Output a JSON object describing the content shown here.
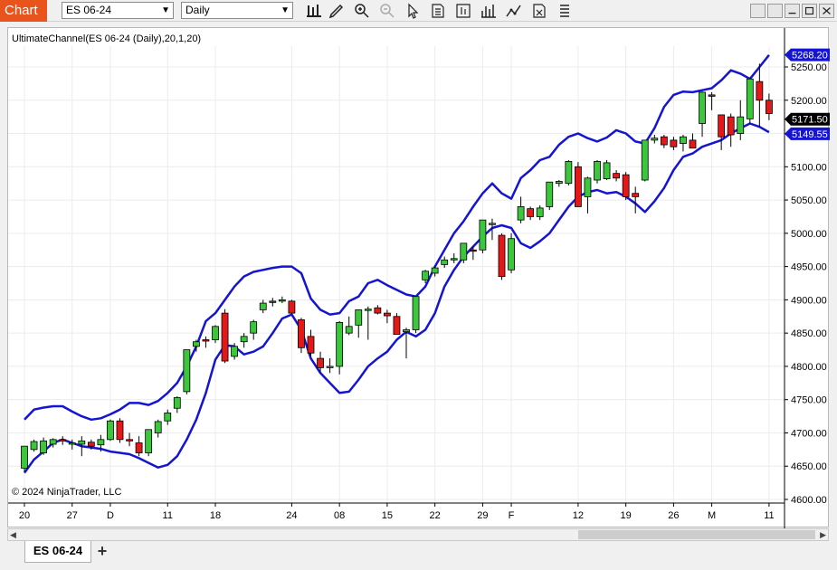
{
  "app": {
    "title": "Chart"
  },
  "toolbar": {
    "instrument": "ES 06-24",
    "period": "Daily",
    "icons": [
      "bar-type-icon",
      "drawing-tool-icon",
      "zoom-in-icon",
      "zoom-out-icon",
      "pointer-icon",
      "data-box-icon",
      "chart-style-icon",
      "indicators-icon",
      "strategies-icon",
      "properties-icon",
      "templates-icon"
    ],
    "window_buttons": [
      "restore-icon",
      "minimize-icon",
      "maximize-icon",
      "close-icon"
    ]
  },
  "chart": {
    "indicator_label": "UltimateChannel(ES 06-24 (Daily),20,1,20)",
    "copyright": "© 2024 NinjaTrader, LLC"
  },
  "tabs": {
    "active": "ES 06-24",
    "add_label": "+"
  },
  "colors": {
    "up": "#3cc63c",
    "down": "#e31919",
    "channel": "#1414d2",
    "accent": "#e8541c",
    "price_tag": "#000000",
    "channel_tag": "#1414d2"
  },
  "chart_data": {
    "type": "candlestick",
    "ylim": [
      4600,
      5300
    ],
    "yticks": [
      "5250.00",
      "5200.00",
      "5150.00",
      "5100.00",
      "5050.00",
      "5000.00",
      "4950.00",
      "4900.00",
      "4850.00",
      "4800.00",
      "4750.00",
      "4700.00",
      "4650.00",
      "4600.00"
    ],
    "xticks": [
      "20",
      "27",
      "D",
      "11",
      "18",
      "24",
      "08",
      "15",
      "22",
      "29",
      "F",
      "12",
      "19",
      "26",
      "M",
      "11"
    ],
    "xtick_bars": [
      0,
      5,
      9,
      15,
      20,
      28,
      33,
      38,
      43,
      48,
      51,
      58,
      63,
      68,
      72,
      78
    ],
    "price_tags": [
      {
        "value": 5268.2,
        "label": "5268.20",
        "kind": "channel"
      },
      {
        "value": 5171.5,
        "label": "5171.50",
        "kind": "price"
      },
      {
        "value": 5149.55,
        "label": "5149.55",
        "kind": "channel"
      }
    ],
    "candles": [
      [
        4647,
        4680,
        4642,
        4680
      ],
      [
        4675,
        4690,
        4672,
        4687
      ],
      [
        4670,
        4693,
        4667,
        4688
      ],
      [
        4683,
        4692,
        4678,
        4690
      ],
      [
        4690,
        4695,
        4682,
        4689
      ],
      [
        4685,
        4690,
        4675,
        4685
      ],
      [
        4683,
        4695,
        4665,
        4688
      ],
      [
        4686,
        4690,
        4675,
        4680
      ],
      [
        4682,
        4697,
        4672,
        4690
      ],
      [
        4690,
        4720,
        4688,
        4718
      ],
      [
        4718,
        4722,
        4685,
        4690
      ],
      [
        4690,
        4700,
        4680,
        4688
      ],
      [
        4685,
        4695,
        4665,
        4670
      ],
      [
        4670,
        4705,
        4665,
        4705
      ],
      [
        4700,
        4720,
        4693,
        4717
      ],
      [
        4718,
        4735,
        4712,
        4730
      ],
      [
        4737,
        4755,
        4730,
        4753
      ],
      [
        4762,
        4825,
        4758,
        4825
      ],
      [
        4830,
        4840,
        4822,
        4837
      ],
      [
        4840,
        4845,
        4828,
        4838
      ],
      [
        4840,
        4862,
        4835,
        4860
      ],
      [
        4880,
        4886,
        4805,
        4808
      ],
      [
        4815,
        4835,
        4810,
        4830
      ],
      [
        4837,
        4850,
        4828,
        4845
      ],
      [
        4850,
        4870,
        4840,
        4867
      ],
      [
        4885,
        4900,
        4880,
        4895
      ],
      [
        4898,
        4903,
        4890,
        4897
      ],
      [
        4898,
        4905,
        4895,
        4900
      ],
      [
        4898,
        4900,
        4882,
        4880
      ],
      [
        4870,
        4873,
        4820,
        4828
      ],
      [
        4845,
        4855,
        4815,
        4820
      ],
      [
        4812,
        4822,
        4790,
        4798
      ],
      [
        4798,
        4812,
        4790,
        4800
      ],
      [
        4800,
        4868,
        4788,
        4866
      ],
      [
        4850,
        4875,
        4847,
        4860
      ],
      [
        4862,
        4875,
        4843,
        4885
      ],
      [
        4886,
        4890,
        4840,
        4886
      ],
      [
        4888,
        4892,
        4878,
        4880
      ],
      [
        4880,
        4885,
        4865,
        4876
      ],
      [
        4875,
        4880,
        4850,
        4848
      ],
      [
        4852,
        4858,
        4812,
        4855
      ],
      [
        4855,
        4900,
        4850,
        4905
      ],
      [
        4930,
        4945,
        4925,
        4943
      ],
      [
        4940,
        4950,
        4935,
        4948
      ],
      [
        4953,
        4965,
        4948,
        4960
      ],
      [
        4960,
        4970,
        4955,
        4962
      ],
      [
        4960,
        4985,
        4955,
        4985
      ],
      [
        4975,
        4980,
        4960,
        4973
      ],
      [
        4975,
        5020,
        4970,
        5020
      ],
      [
        5015,
        5022,
        4990,
        5015
      ],
      [
        4997,
        5000,
        4930,
        4935
      ],
      [
        4945,
        5000,
        4940,
        4992
      ],
      [
        5020,
        5055,
        5015,
        5040
      ],
      [
        5037,
        5040,
        5020,
        5025
      ],
      [
        5025,
        5042,
        5020,
        5038
      ],
      [
        5040,
        5075,
        5035,
        5077
      ],
      [
        5075,
        5080,
        5070,
        5078
      ],
      [
        5075,
        5110,
        5072,
        5108
      ],
      [
        5100,
        5107,
        5040,
        5040
      ],
      [
        5055,
        5085,
        5030,
        5083
      ],
      [
        5080,
        5110,
        5075,
        5108
      ],
      [
        5082,
        5110,
        5080,
        5106
      ],
      [
        5090,
        5095,
        5078,
        5083
      ],
      [
        5088,
        5092,
        5050,
        5055
      ],
      [
        5060,
        5070,
        5030,
        5055
      ],
      [
        5080,
        5140,
        5078,
        5140
      ],
      [
        5140,
        5148,
        5135,
        5143
      ],
      [
        5145,
        5148,
        5128,
        5133
      ],
      [
        5140,
        5145,
        5125,
        5130
      ],
      [
        5135,
        5148,
        5123,
        5145
      ],
      [
        5140,
        5150,
        5130,
        5128
      ],
      [
        5165,
        5213,
        5145,
        5212
      ],
      [
        5208,
        5212,
        5185,
        5206
      ],
      [
        5178,
        5175,
        5125,
        5145
      ],
      [
        5175,
        5180,
        5130,
        5148
      ],
      [
        5150,
        5200,
        5140,
        5175
      ],
      [
        5172,
        5234,
        5165,
        5232
      ],
      [
        5228,
        5255,
        5160,
        5200
      ],
      [
        5200,
        5210,
        5170,
        5180
      ]
    ],
    "upper_channel": [
      4720,
      4735,
      4738,
      4740,
      4740,
      4732,
      4725,
      4720,
      4722,
      4728,
      4735,
      4745,
      4745,
      4742,
      4748,
      4760,
      4775,
      4800,
      4830,
      4868,
      4880,
      4900,
      4920,
      4935,
      4942,
      4945,
      4948,
      4950,
      4950,
      4940,
      4902,
      4885,
      4878,
      4880,
      4898,
      4905,
      4925,
      4930,
      4922,
      4915,
      4908,
      4905,
      4920,
      4950,
      4975,
      5000,
      5018,
      5040,
      5060,
      5075,
      5060,
      5052,
      5083,
      5095,
      5110,
      5115,
      5133,
      5145,
      5150,
      5143,
      5138,
      5144,
      5155,
      5150,
      5138,
      5135,
      5158,
      5190,
      5208,
      5213,
      5212,
      5215,
      5218,
      5230,
      5245,
      5240,
      5232,
      5250,
      5268
    ],
    "lower_channel": [
      4640,
      4660,
      4672,
      4685,
      4690,
      4685,
      4680,
      4678,
      4676,
      4672,
      4670,
      4668,
      4662,
      4655,
      4648,
      4652,
      4665,
      4690,
      4720,
      4760,
      4810,
      4832,
      4830,
      4818,
      4822,
      4830,
      4850,
      4872,
      4878,
      4855,
      4812,
      4790,
      4775,
      4760,
      4762,
      4780,
      4800,
      4812,
      4822,
      4840,
      4852,
      4845,
      4855,
      4880,
      4920,
      4945,
      4965,
      4980,
      4995,
      5008,
      5012,
      5008,
      4985,
      4978,
      4988,
      5000,
      5020,
      5040,
      5055,
      5062,
      5065,
      5060,
      5062,
      5055,
      5045,
      5032,
      5048,
      5068,
      5095,
      5115,
      5120,
      5130,
      5135,
      5140,
      5150,
      5158,
      5165,
      5160,
      5152
    ]
  }
}
